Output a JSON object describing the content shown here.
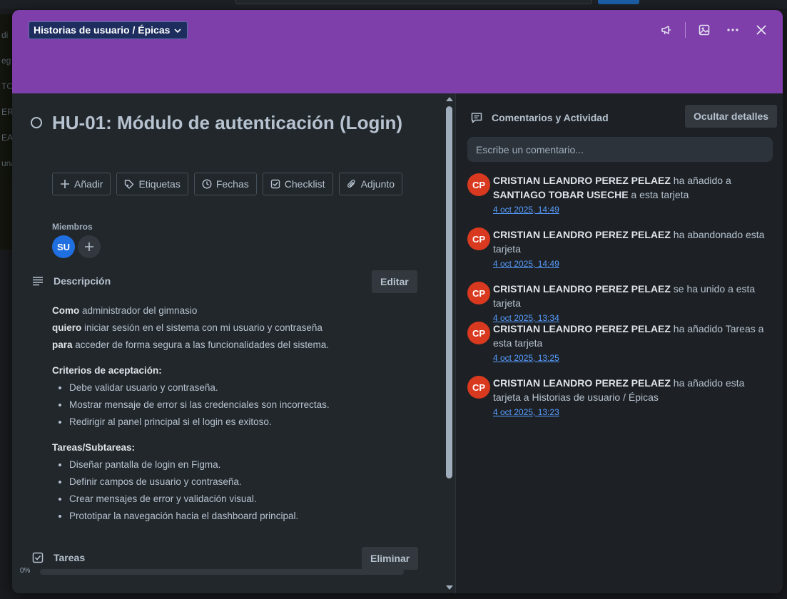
{
  "background": {
    "side_labels": [
      "di",
      "eg",
      "TC",
      "ER",
      "EA",
      "una"
    ]
  },
  "header": {
    "list_name": "Historias de usuario / Épicas",
    "icons": [
      "megaphone-icon",
      "image-icon",
      "more-icon",
      "close-icon"
    ],
    "cover_color": "#7f3fab"
  },
  "card": {
    "title": "HU-01: Módulo de autenticación (Login)",
    "actions": [
      {
        "label": "Añadir",
        "icon": "plus-icon"
      },
      {
        "label": "Etiquetas",
        "icon": "tag-icon"
      },
      {
        "label": "Fechas",
        "icon": "clock-icon"
      },
      {
        "label": "Checklist",
        "icon": "checkbox-icon"
      },
      {
        "label": "Adjunto",
        "icon": "paperclip-icon"
      }
    ],
    "members": {
      "label": "Miembros",
      "avatars": [
        {
          "initials": "SU",
          "color": "#1f6fe0"
        }
      ]
    },
    "description": {
      "title": "Descripción",
      "edit_label": "Editar",
      "lines": [
        {
          "bold": "Como",
          "text": " administrador del gimnasio"
        },
        {
          "bold": "quiero",
          "text": " iniciar sesión en el sistema con mi usuario y contraseña"
        },
        {
          "bold": "para",
          "text": " acceder de forma segura a las funcionalidades del sistema."
        }
      ],
      "criteria_title": "Criterios de aceptación:",
      "criteria": [
        "Debe validar usuario y contraseña.",
        "Mostrar mensaje de error si las credenciales son incorrectas.",
        "Redirigir al panel principal si el login es exitoso."
      ],
      "tasks_title": "Tareas/Subtareas:",
      "tasks": [
        "Diseñar pantalla de login en Figma.",
        "Definir campos de usuario y contraseña.",
        "Crear mensajes de error y validación visual.",
        "Prototipar la navegación hacia el dashboard principal."
      ]
    },
    "checklist": {
      "title": "Tareas",
      "delete_label": "Eliminar",
      "progress_label": "0%",
      "progress": 0
    }
  },
  "activity": {
    "title": "Comentarios y Actividad",
    "toggle_label": "Ocultar detalles",
    "comment_placeholder": "Escribe un comentario...",
    "items": [
      {
        "initials": "CP",
        "who": "CRISTIAN LEANDRO PEREZ PELAEZ",
        "pre": " ha añadido a ",
        "target": "SANTIAGO TOBAR USECHE",
        "post": " a esta tarjeta",
        "time": "4 oct 2025, 14:49"
      },
      {
        "initials": "CP",
        "who": "CRISTIAN LEANDRO PEREZ PELAEZ",
        "pre": " ha abandonado esta tarjeta",
        "target": "",
        "post": "",
        "time": "4 oct 2025, 14:49"
      },
      {
        "initials": "CP",
        "who": "CRISTIAN LEANDRO PEREZ PELAEZ",
        "pre": " se ha unido a esta tarjeta",
        "target": "",
        "post": "",
        "time": "4 oct 2025, 13:34"
      },
      {
        "initials": "CP",
        "who": "CRISTIAN LEANDRO PEREZ PELAEZ",
        "pre": " ha añadido Tareas a esta tarjeta",
        "target": "",
        "post": "",
        "time": "4 oct 2025, 13:25"
      },
      {
        "initials": "CP",
        "who": "CRISTIAN LEANDRO PEREZ PELAEZ",
        "pre": " ha añadido esta tarjeta a Historias de usuario / Épicas",
        "target": "",
        "post": "",
        "time": "4 oct 2025, 13:23"
      }
    ]
  }
}
